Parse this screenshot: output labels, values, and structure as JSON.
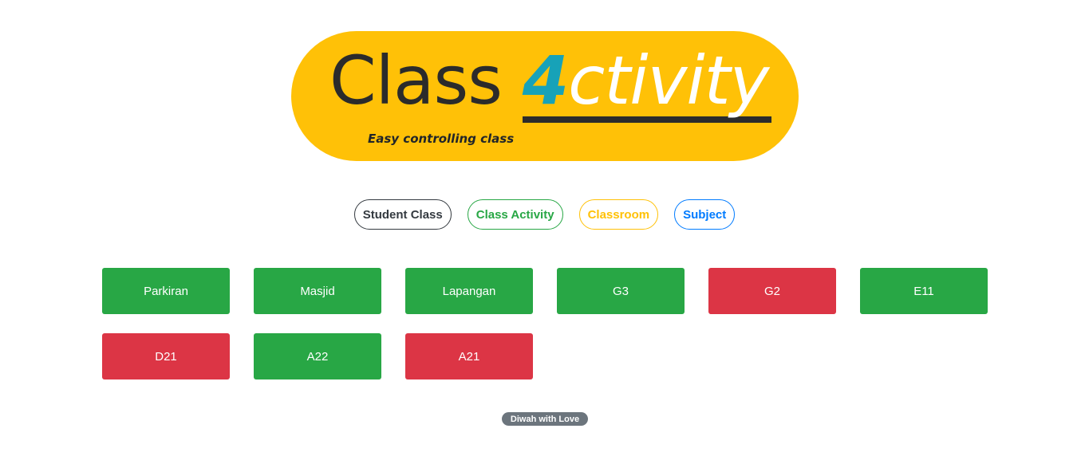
{
  "hero": {
    "title_word": "Class",
    "brand_digit": "4",
    "brand_rest": "ctivity",
    "tagline": "Easy controlling class",
    "background_color": "#ffc107",
    "digit_color": "#17a2b8"
  },
  "nav": {
    "items": [
      {
        "label": "Student Class",
        "color": "#343a40"
      },
      {
        "label": "Class Activity",
        "color": "#28a745"
      },
      {
        "label": "Classroom",
        "color": "#ffc107"
      },
      {
        "label": "Subject",
        "color": "#007bff"
      }
    ]
  },
  "status_colors": {
    "available": "#28a745",
    "occupied": "#dc3545"
  },
  "rooms": [
    {
      "name": "Parkiran",
      "status": "available"
    },
    {
      "name": "Masjid",
      "status": "available"
    },
    {
      "name": "Lapangan",
      "status": "available"
    },
    {
      "name": "G3",
      "status": "available"
    },
    {
      "name": "G2",
      "status": "occupied"
    },
    {
      "name": "E11",
      "status": "available"
    },
    {
      "name": "D21",
      "status": "occupied"
    },
    {
      "name": "A22",
      "status": "available"
    },
    {
      "name": "A21",
      "status": "occupied"
    }
  ],
  "footer": {
    "badge": "Diwah with Love",
    "badge_color": "#6c757d"
  }
}
